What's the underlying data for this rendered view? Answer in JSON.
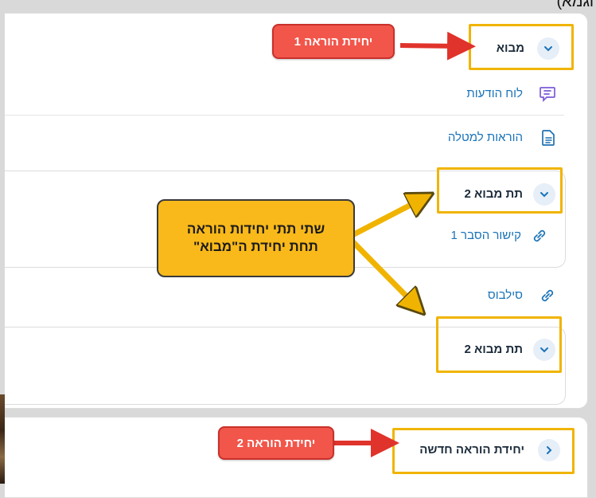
{
  "caption_fragment": "(לדוגמא).",
  "units": {
    "unit1_title": "מבוא",
    "sub_unit_a_title": "תת מבוא 2",
    "sub_unit_b_title": "תת מבוא 2",
    "unit2_title": "יחידת הוראה חדשה"
  },
  "items": {
    "announcements": "לוח הודעות",
    "task_instructions": "הוראות למטלה",
    "explain_link": "קישור הסבר 1",
    "syllabus": "סילבוס"
  },
  "annotations": {
    "red_tag_1": "יחידת הוראה 1",
    "red_tag_2": "יחידת הוראה 2",
    "note_line1": "שתי תתי יחידות הוראה",
    "note_line2": "תחת יחידת ה\"מבוא\""
  },
  "colors": {
    "accent_blue": "#1a73b8",
    "annotation_red": "#f2564b",
    "annotation_yellow": "#f9b91a",
    "highlight_border": "#f0b400"
  },
  "icons": {
    "announcements": "chat-bubble-icon",
    "task_instructions": "document-icon",
    "links": "link-icon",
    "expanded": "chevron-down-icon",
    "collapsed": "chevron-right-icon"
  }
}
